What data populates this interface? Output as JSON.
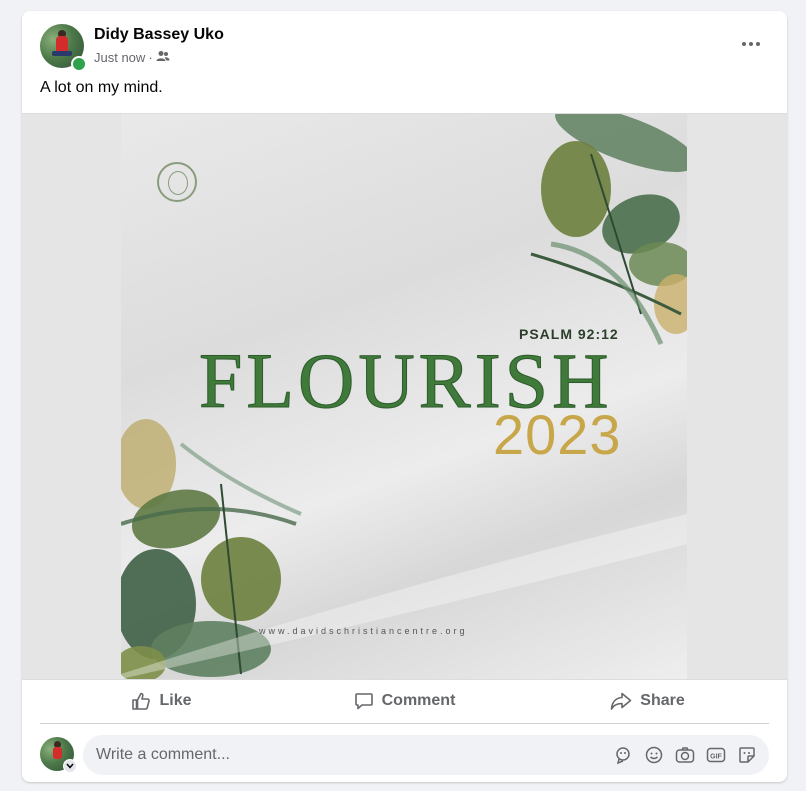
{
  "post": {
    "author": "Didy Bassey Uko",
    "timestamp": "Just now",
    "separator": "·",
    "audience_icon": "friends-icon",
    "text": "A lot on my mind."
  },
  "poster": {
    "scripture": "PSALM 92:12",
    "headline": "FLOURISH",
    "year": "2023",
    "url": "www.davidschristiancentre.org"
  },
  "actions": {
    "like": "Like",
    "comment": "Comment",
    "share": "Share"
  },
  "comment_box": {
    "placeholder": "Write a comment..."
  },
  "icons": [
    "more-options-icon",
    "like-icon",
    "comment-icon",
    "share-icon",
    "avatar-sticker-icon",
    "emoji-icon",
    "camera-icon",
    "gif-icon",
    "sticker-icon"
  ],
  "colors": {
    "online": "#31a24c",
    "muted_text": "#65676b",
    "headline_green": "#3f7a3a",
    "year_gold": "#c8a64a"
  }
}
